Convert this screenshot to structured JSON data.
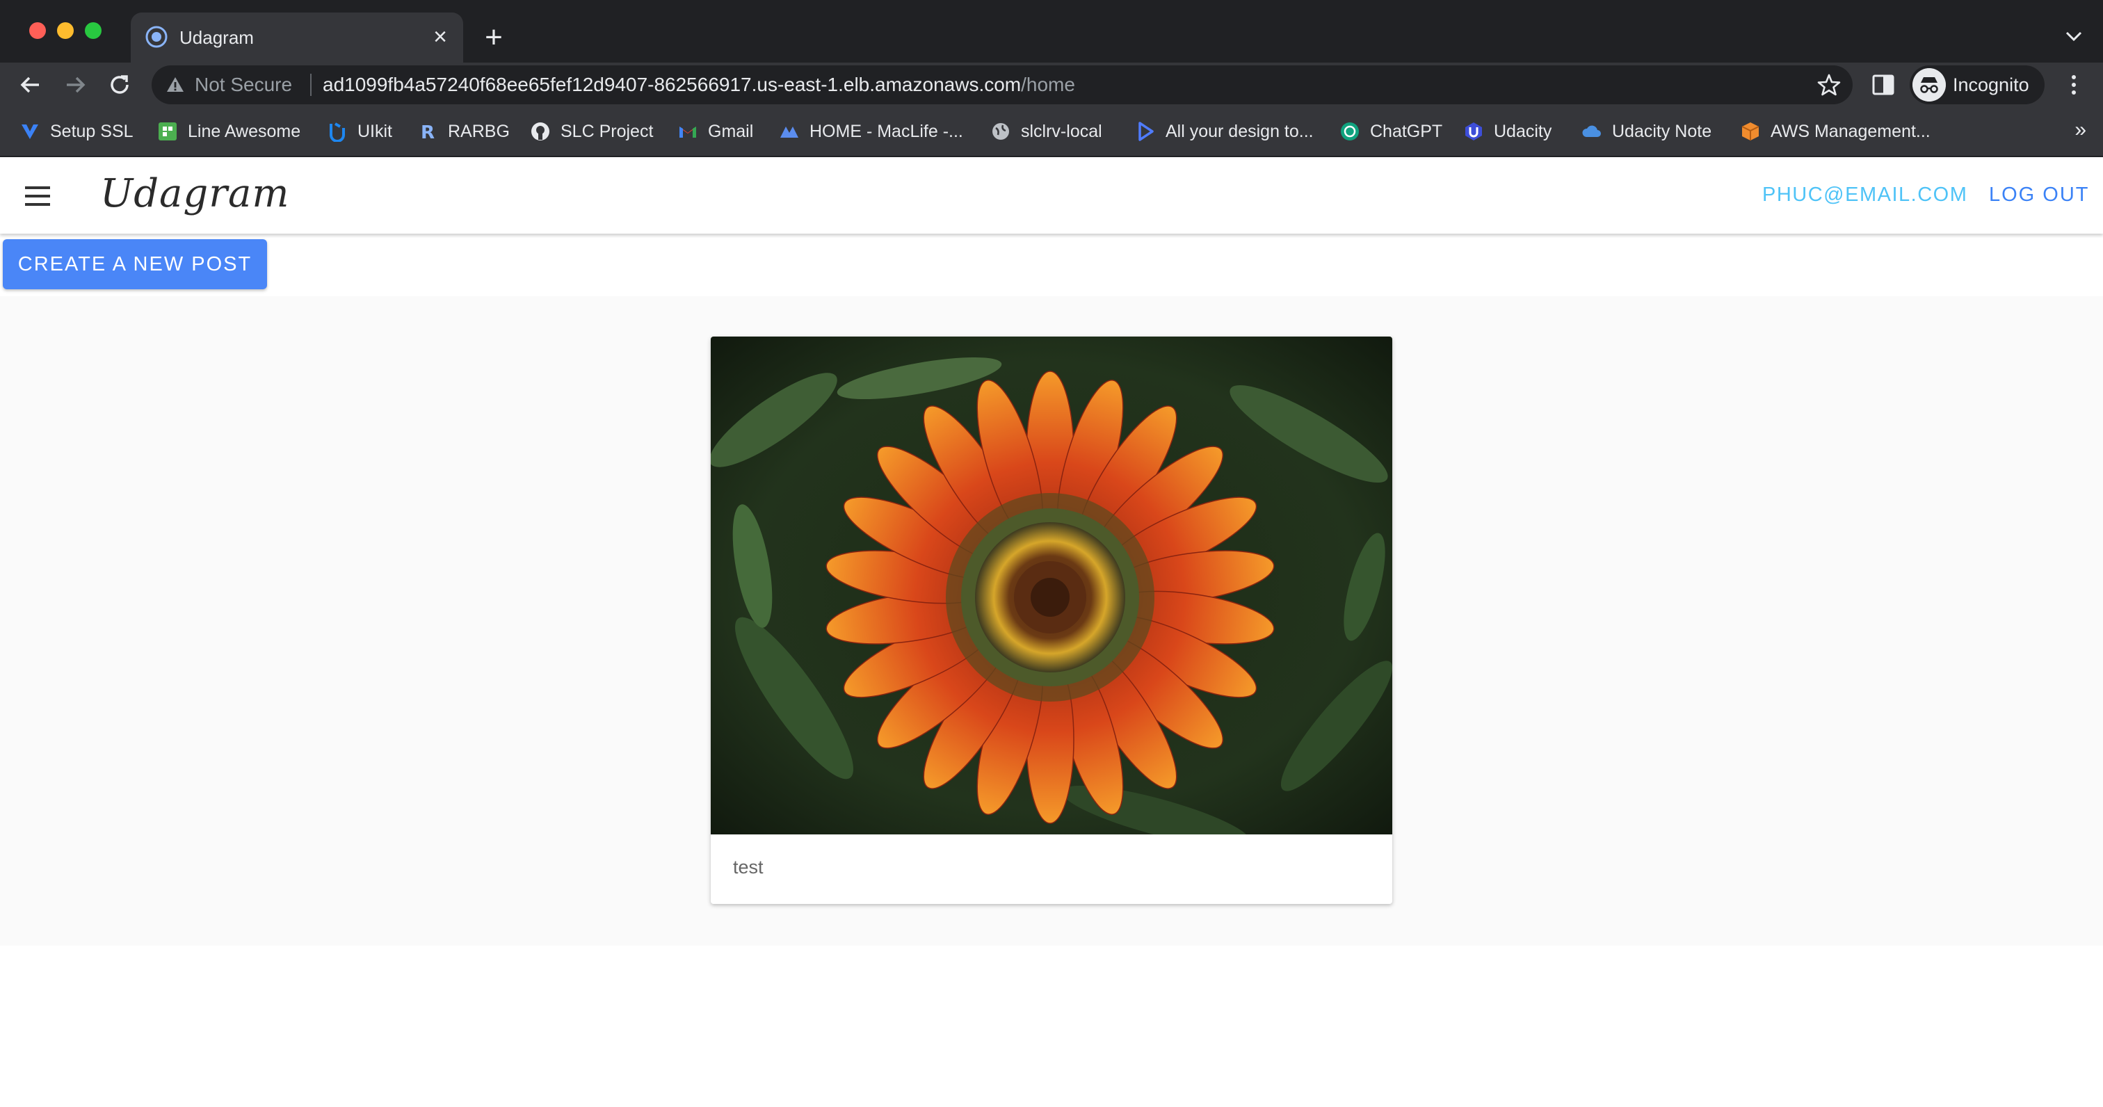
{
  "browser": {
    "tab": {
      "title": "Udagram"
    },
    "address": {
      "security": "Not Secure",
      "host": "ad1099fb4a57240f68ee65fef12d9407-862566917.us-east-1.elb.amazonaws.com",
      "path": "/home"
    },
    "profile": {
      "label": "Incognito"
    },
    "bookmarks": [
      {
        "label": "Setup SSL",
        "icon": "vercel-icon",
        "color": "#3b82f6"
      },
      {
        "label": "Line Awesome",
        "icon": "line-awesome-icon",
        "color": "#4caf50"
      },
      {
        "label": "UIkit",
        "icon": "uikit-icon",
        "color": "#1e87f0"
      },
      {
        "label": "RARBG",
        "icon": "rarbg-icon",
        "color": "#8ab4f8"
      },
      {
        "label": "SLC Project",
        "icon": "github-icon",
        "color": "#e8eaed"
      },
      {
        "label": "Gmail",
        "icon": "gmail-icon",
        "color": "#ea4335"
      },
      {
        "label": "HOME - MacLife -...",
        "icon": "maclife-icon",
        "color": "#5b8def"
      },
      {
        "label": "slclrv-local",
        "icon": "globe-icon",
        "color": "#bdc1c6"
      },
      {
        "label": "All your design to...",
        "icon": "play-icon",
        "color": "#4f7cff"
      },
      {
        "label": "ChatGPT",
        "icon": "chatgpt-icon",
        "color": "#10a37f"
      },
      {
        "label": "Udacity",
        "icon": "udacity-icon",
        "color": "#3d4ed8"
      },
      {
        "label": "Udacity Note",
        "icon": "cloud-icon",
        "color": "#4a90e2"
      },
      {
        "label": "AWS Management...",
        "icon": "aws-icon",
        "color": "#f08c2e"
      }
    ],
    "bookmarks_more": "»"
  },
  "app": {
    "brand": "Udagram",
    "user_email": "PHUC@EMAIL.COM",
    "logout": "LOG OUT",
    "create_post": "CREATE A NEW POST",
    "posts": [
      {
        "caption": "test",
        "image": "orange-gazania-flower-photo"
      }
    ]
  }
}
